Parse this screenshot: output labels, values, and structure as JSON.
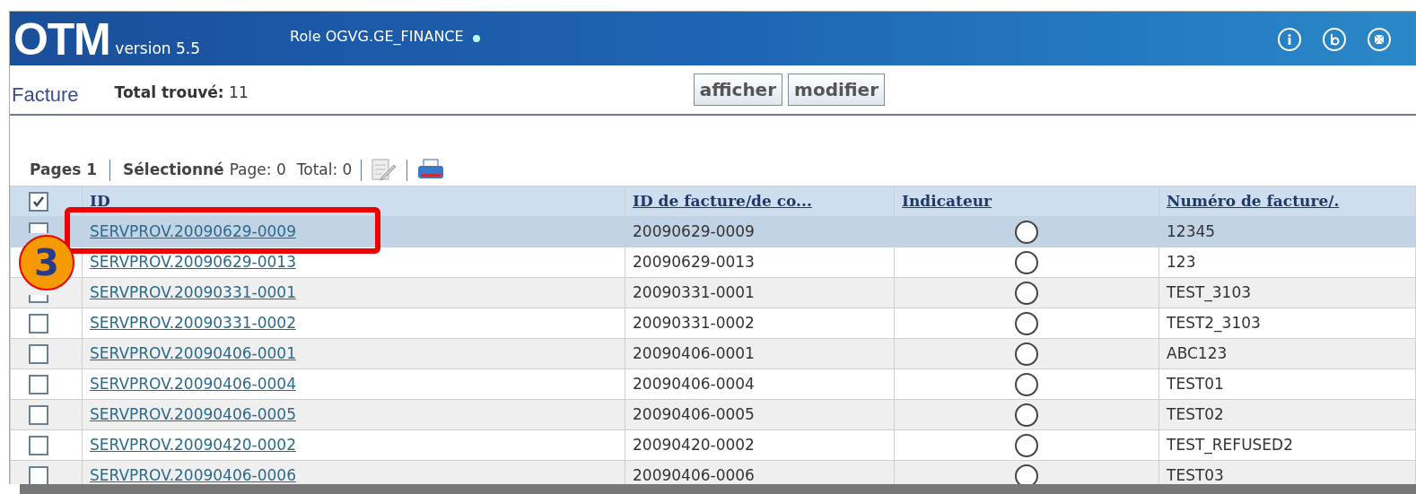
{
  "header": {
    "logo": "OTM",
    "version": "version 5.5",
    "role": "Role OGVG.GE_FINANCE"
  },
  "toolbar": {
    "title": "Facture",
    "total_label": "Total trouvé:",
    "total_value": "11",
    "buttons": [
      "afficher",
      "modifier"
    ]
  },
  "pager": {
    "pages_label": "Pages 1",
    "selected_label": "Sélectionné",
    "page_count": "Page: 0",
    "total_count": "Total: 0"
  },
  "table": {
    "select_all_checked": true,
    "columns": [
      "ID",
      "ID de facture/de co...",
      "Indicateur",
      "Numéro de facture/."
    ],
    "rows": [
      {
        "id": "SERVPROV.20090629-0009",
        "invoice_id": "20090629-0009",
        "number": "12345",
        "selected": true,
        "checked": false
      },
      {
        "id": "SERVPROV.20090629-0013",
        "invoice_id": "20090629-0013",
        "number": "123",
        "selected": false
      },
      {
        "id": "SERVPROV.20090331-0001",
        "invoice_id": "20090331-0001",
        "number": "TEST_3103",
        "selected": false,
        "checked": false
      },
      {
        "id": "SERVPROV.20090331-0002",
        "invoice_id": "20090331-0002",
        "number": "TEST2_3103",
        "selected": false,
        "checked": false
      },
      {
        "id": "SERVPROV.20090406-0001",
        "invoice_id": "20090406-0001",
        "number": "ABC123",
        "selected": false,
        "checked": false
      },
      {
        "id": "SERVPROV.20090406-0004",
        "invoice_id": "20090406-0004",
        "number": "TEST01",
        "selected": false,
        "checked": false
      },
      {
        "id": "SERVPROV.20090406-0005",
        "invoice_id": "20090406-0005",
        "number": "TEST02",
        "selected": false,
        "checked": false
      },
      {
        "id": "SERVPROV.20090420-0002",
        "invoice_id": "20090420-0002",
        "number": "TEST_REFUSED2",
        "selected": false,
        "checked": false
      },
      {
        "id": "SERVPROV.20090406-0006",
        "invoice_id": "20090406-0006",
        "number": "TEST03",
        "selected": false,
        "checked": false
      }
    ]
  },
  "callout": {
    "number": "3"
  }
}
